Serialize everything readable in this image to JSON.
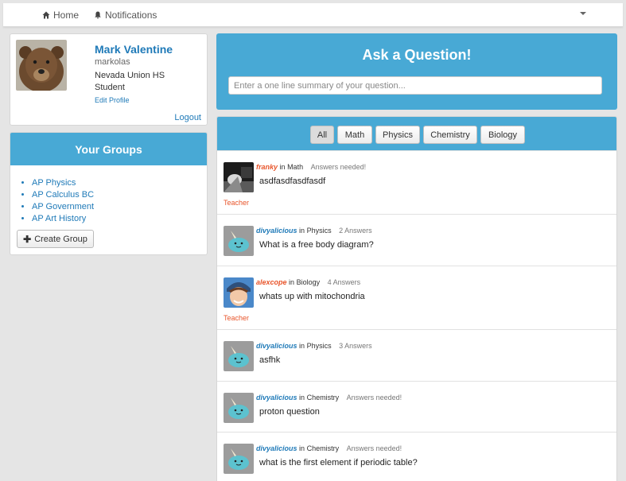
{
  "nav": {
    "home_label": "Home",
    "notifications_label": "Notifications"
  },
  "profile": {
    "name": "Mark Valentine",
    "username": "markolas",
    "school": "Nevada Union HS",
    "role": "Student",
    "edit_label": "Edit Profile",
    "logout_label": "Logout"
  },
  "groups": {
    "title": "Your Groups",
    "items": [
      "AP Physics",
      "AP Calculus BC",
      "AP Government",
      "AP Art History"
    ],
    "create_label": "Create Group"
  },
  "ask": {
    "title": "Ask a Question!",
    "placeholder": "Enter a one line summary of your question..."
  },
  "filters": [
    "All",
    "Math",
    "Physics",
    "Chemistry",
    "Biology"
  ],
  "posts": [
    {
      "user": "franky",
      "in": "in",
      "group": "Math",
      "answers": "Answers needed!",
      "title": "asdfasdfasdfasdf",
      "role": "Teacher"
    },
    {
      "user": "divyalicious",
      "in": "in",
      "group": "Physics",
      "answers": "2 Answers",
      "title": "What is a free body diagram?"
    },
    {
      "user": "alexcope",
      "in": "in",
      "group": "Biology",
      "answers": "4 Answers",
      "title": "whats up with mitochondria",
      "role": "Teacher"
    },
    {
      "user": "divyalicious",
      "in": "in",
      "group": "Physics",
      "answers": "3 Answers",
      "title": "asfhk"
    },
    {
      "user": "divyalicious",
      "in": "in",
      "group": "Chemistry",
      "answers": "Answers needed!",
      "title": "proton question"
    },
    {
      "user": "divyalicious",
      "in": "in",
      "group": "Chemistry",
      "answers": "Answers needed!",
      "title": "what is the first element if periodic table?"
    }
  ],
  "colors": {
    "accent": "#48a9d5",
    "link": "#1f7ab8",
    "teacher": "#e8552b",
    "background": "#e5e5e5"
  },
  "icons": {
    "home": "home-icon",
    "notifications": "bell-icon",
    "dropdown": "caret-down-icon",
    "create": "plus-icon"
  }
}
